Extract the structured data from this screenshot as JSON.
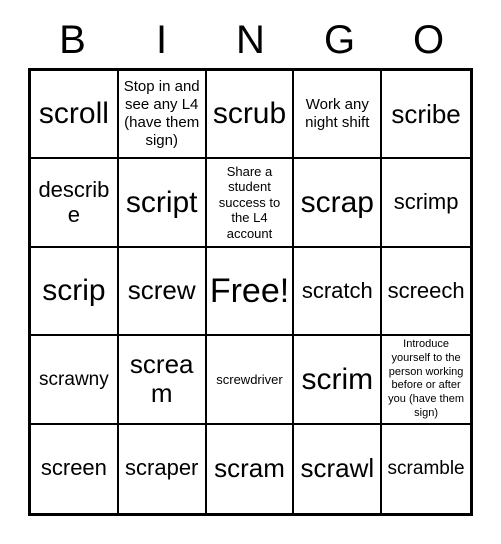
{
  "card": {
    "title": "BINGO",
    "headers": [
      "B",
      "I",
      "N",
      "G",
      "O"
    ],
    "free_space_label": "Free!",
    "rows": [
      [
        {
          "text": "scroll",
          "size": "xl"
        },
        {
          "text": "Stop in and see any L4 (have them sign)",
          "size": "xs"
        },
        {
          "text": "scrub",
          "size": "xl"
        },
        {
          "text": "Work any night shift",
          "size": "xs"
        },
        {
          "text": "scribe",
          "size": "lg"
        }
      ],
      [
        {
          "text": "describe",
          "size": "md"
        },
        {
          "text": "script",
          "size": "xl"
        },
        {
          "text": "Share a student success to the L4 account",
          "size": "xxs"
        },
        {
          "text": "scrap",
          "size": "xl"
        },
        {
          "text": "scrimp",
          "size": "md"
        }
      ],
      [
        {
          "text": "scrip",
          "size": "xl"
        },
        {
          "text": "screw",
          "size": "lg"
        },
        {
          "text": "Free!",
          "size": "xxl"
        },
        {
          "text": "scratch",
          "size": "md"
        },
        {
          "text": "screech",
          "size": "md"
        }
      ],
      [
        {
          "text": "scrawny",
          "size": "sm"
        },
        {
          "text": "scream",
          "size": "lg"
        },
        {
          "text": "screwdriver",
          "size": "xxs"
        },
        {
          "text": "scrim",
          "size": "xl"
        },
        {
          "text": "Introduce yourself to the person working before or after you (have them sign)",
          "size": "tiny"
        }
      ],
      [
        {
          "text": "screen",
          "size": "md"
        },
        {
          "text": "scraper",
          "size": "md"
        },
        {
          "text": "scram",
          "size": "lg"
        },
        {
          "text": "scrawl",
          "size": "lg"
        },
        {
          "text": "scramble",
          "size": "sm"
        }
      ]
    ]
  },
  "colors": {
    "background": "#ffffff",
    "text": "#000000",
    "border": "#000000"
  }
}
